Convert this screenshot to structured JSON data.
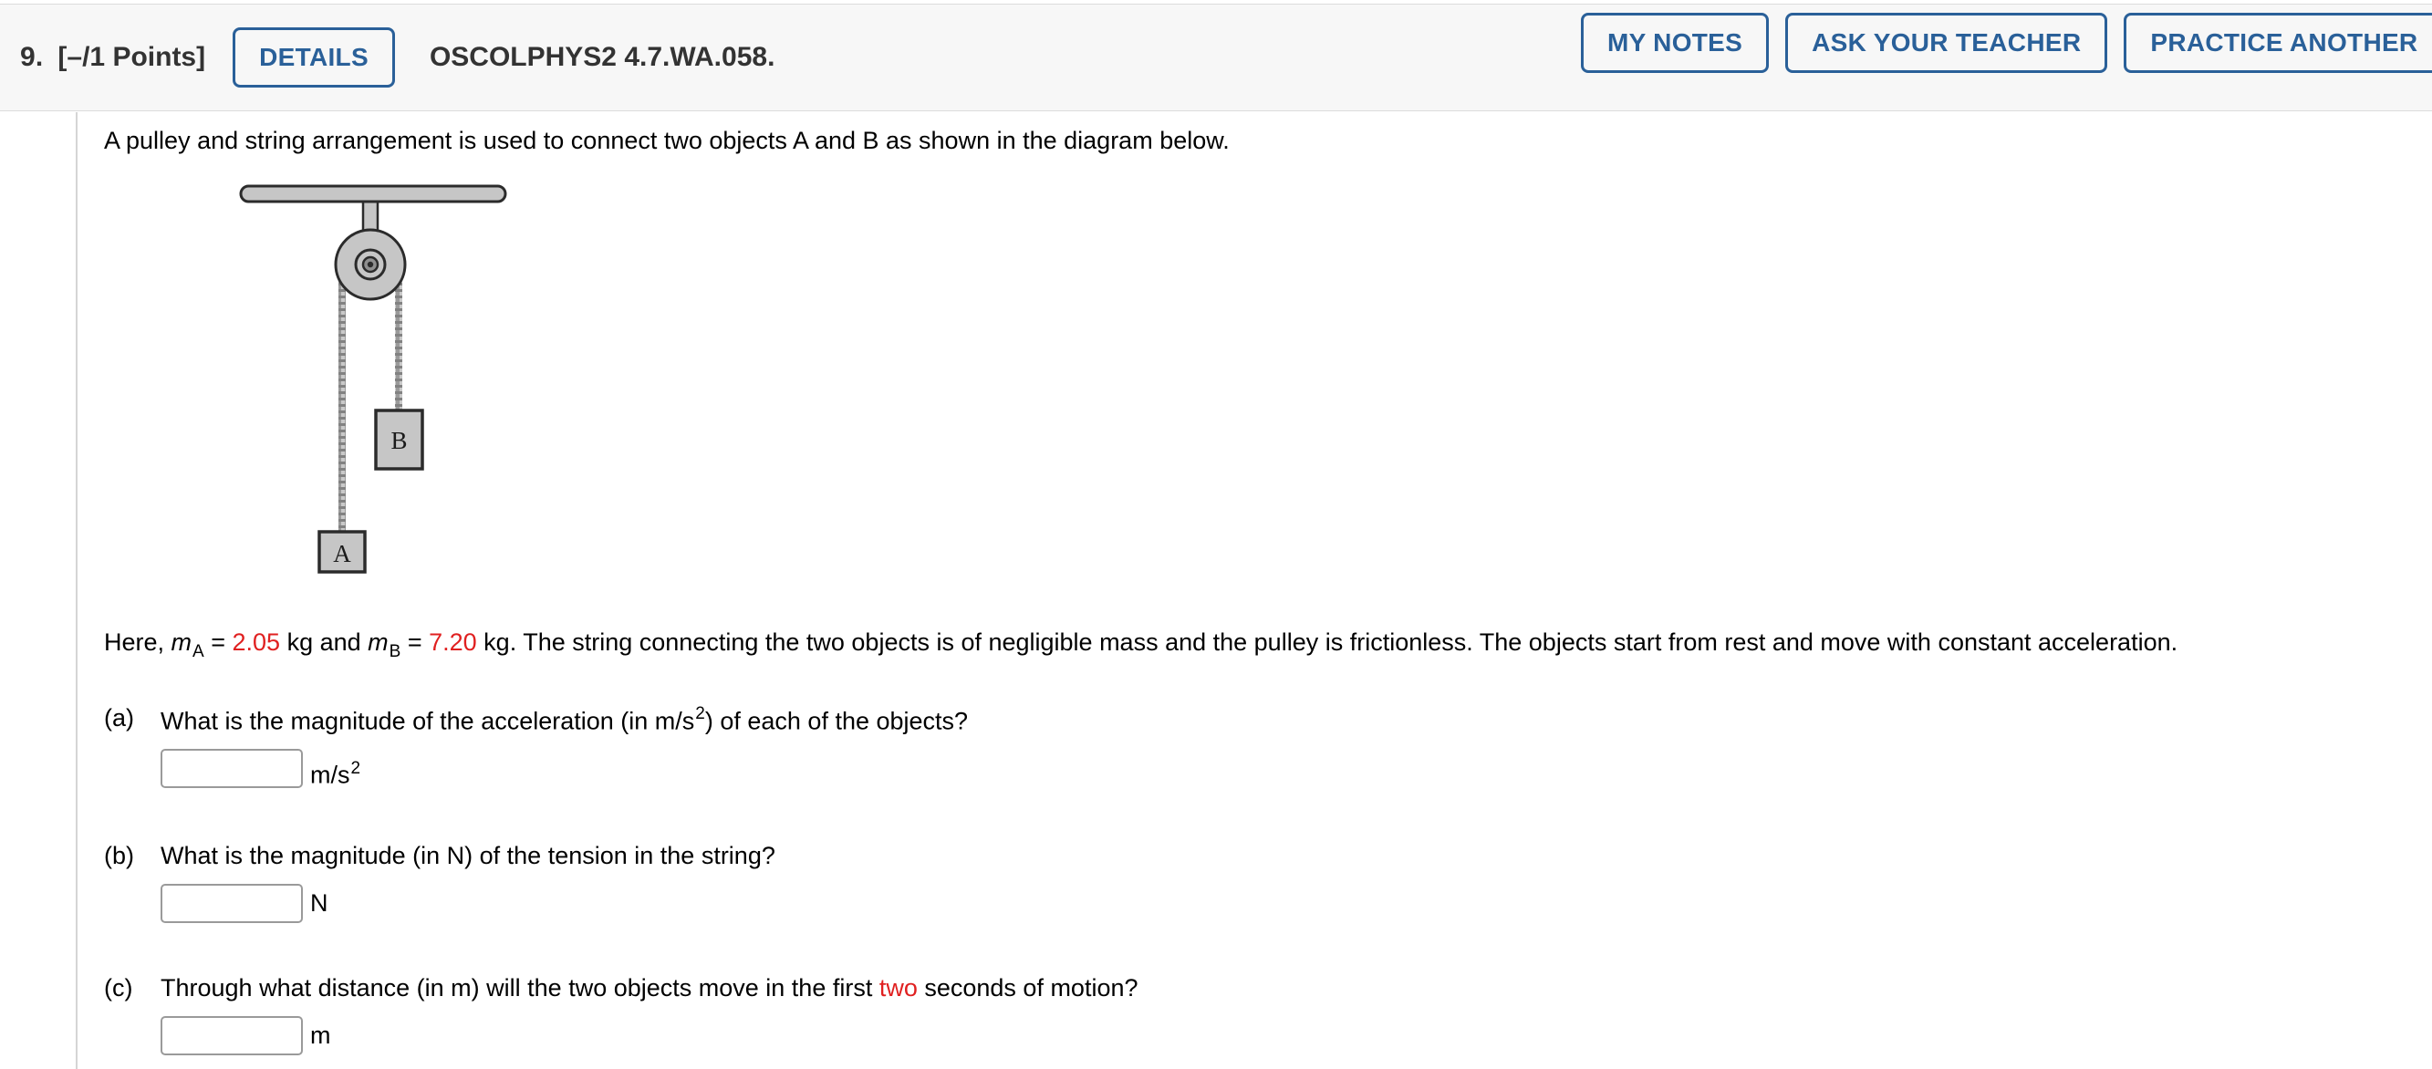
{
  "header": {
    "question_number": "9.",
    "points": "[–/1 Points]",
    "details_label": "DETAILS",
    "problem_id": "OSCOLPHYS2 4.7.WA.058.",
    "my_notes_label": "MY NOTES",
    "ask_teacher_label": "ASK YOUR TEACHER",
    "practice_another_label": "PRACTICE ANOTHER",
    "accent_color": "#2a6099",
    "background_color": "#f7f7f7"
  },
  "body": {
    "intro": "A pulley and string arrangement is used to connect two objects A and B as shown in the diagram below.",
    "given": {
      "prefix": "Here, ",
      "m_symbol": "m",
      "sub_a": "A",
      "eq": " = ",
      "mass_a": "2.05",
      "unit_a": " kg and ",
      "sub_b": "B",
      "mass_b": "7.20",
      "suffix": " kg. The string connecting the two objects is of negligible mass and the pulley is frictionless. The objects start from rest and move with constant acceleration."
    },
    "diagram": {
      "block_a_label": "A",
      "block_b_label": "B",
      "fill_color": "#c6c6c6",
      "stroke_color": "#2b2b2b"
    },
    "parts": [
      {
        "id": "a",
        "label": "(a)",
        "text_1": "What is the magnitude of the acceleration (in m/s",
        "exponent": "2",
        "text_2": ") of each of the objects?",
        "answer_value": "",
        "answer_placeholder": "",
        "unit": "m/s",
        "unit_exponent": "2"
      },
      {
        "id": "b",
        "label": "(b)",
        "text_1": "What is the magnitude (in N) of the tension in the string?",
        "exponent": "",
        "text_2": "",
        "answer_value": "",
        "answer_placeholder": "",
        "unit": "N",
        "unit_exponent": ""
      },
      {
        "id": "c",
        "label": "(c)",
        "text_1": "Through what distance (in m) will the two objects move in the first ",
        "highlight": "two",
        "text_2": " seconds of motion?",
        "answer_value": "",
        "answer_placeholder": "",
        "unit": "m",
        "unit_exponent": ""
      }
    ]
  }
}
